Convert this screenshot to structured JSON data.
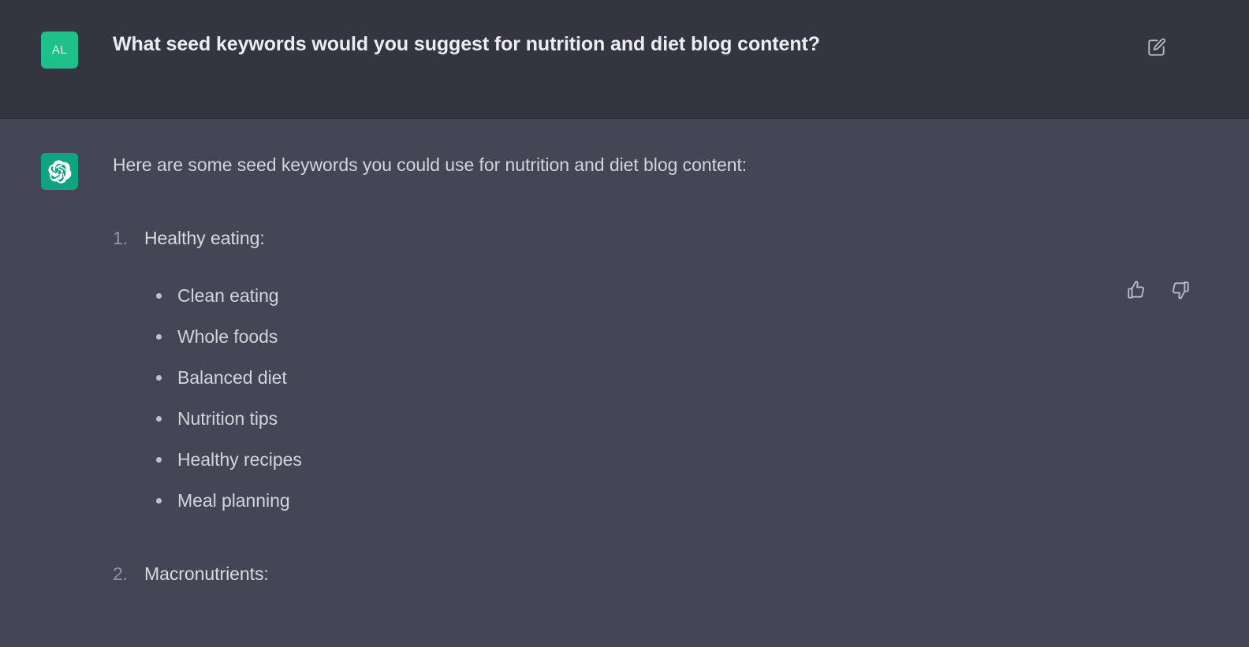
{
  "conversation": {
    "user_message": {
      "avatar_initials": "AL",
      "avatar_color": "#1fc08a",
      "text": "What seed keywords would you suggest for nutrition and diet blog content?",
      "edit_action_label": "Edit message"
    },
    "assistant_message": {
      "avatar_color": "#10a37f",
      "avatar_icon": "openai-logo-icon",
      "intro": "Here are some seed keywords you could use for nutrition and diet blog content:",
      "outline": [
        {
          "marker": "1.",
          "title": "Healthy eating:",
          "items": [
            "Clean eating",
            "Whole foods",
            "Balanced diet",
            "Nutrition tips",
            "Healthy recipes",
            "Meal planning"
          ]
        },
        {
          "marker": "2.",
          "title": "Macronutrients:",
          "items": []
        }
      ],
      "feedback": {
        "thumbs_up_label": "Good response",
        "thumbs_down_label": "Bad response"
      }
    }
  },
  "theme": {
    "user_background": "#343541",
    "assistant_background": "#444654",
    "text_color": "#d1d5db",
    "muted_text_color": "#9095a2",
    "accent_green": "#10a37f"
  }
}
